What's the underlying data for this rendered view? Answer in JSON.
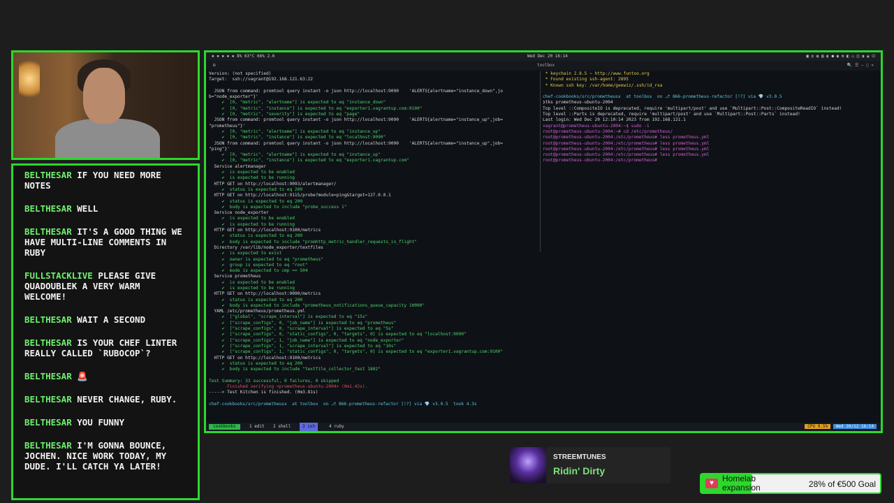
{
  "chat": [
    {
      "user": "BELTHESAR",
      "text": "IF YOU NEED MORE NOTES"
    },
    {
      "user": "BELTHESAR",
      "text": "WELL"
    },
    {
      "user": "BELTHESAR",
      "text": "IT'S A GOOD THING WE HAVE MULTI-LINE COMMENTS IN RUBY"
    },
    {
      "user": "FULLSTACKLIVE",
      "text": "PLEASE GIVE QUADOUBLEK A VERY WARM WELCOME!"
    },
    {
      "user": "BELTHESAR",
      "text": "WAIT A SECOND"
    },
    {
      "user": "BELTHESAR",
      "text": "IS YOUR CHEF LINTER REALLY CALLED `RUBOCOP`?"
    },
    {
      "user": "BELTHESAR",
      "text": "🚨"
    },
    {
      "user": "BELTHESAR",
      "text": "NEVER CHANGE, RUBY."
    },
    {
      "user": "BELTHESAR",
      "text": "YOU FUNNY"
    },
    {
      "user": "BELTHESAR",
      "text": "I'M GONNA BOUNCE, JOCHEN. NICE WORK TODAY, MY DUDE. I'LL CATCH YA LATER!"
    }
  ],
  "screen": {
    "sysbar_left": "▪ ▪ ▪ ▪ ▪   8%   63°C   66%   2.6",
    "sysbar_center": "Wed Dec 20 16:14",
    "window_title": "toolbox",
    "left_lines": [
      "Version: (not specified)",
      "Target:  ssh://vagrant@192.168.121.63:22",
      "",
      "  JSON from command: promtool query instant -o json http://localhost:9090    'ALERTS{alertname=\"instance_down\",jo",
      "b=\"node_exporter\"}'",
      "     ✔  [0, \"metric\", \"alertname\"] is expected to eq \"instance_down\"",
      "     ✔  [0, \"metric\", \"instance\"] is expected to eq \"exporter1.vagrantup.com:9100\"",
      "     ✔  [0, \"metric\", \"severity\"] is expected to eq \"page\"",
      "  JSON from command: promtool query instant -o json http://localhost:9090    'ALERTS{alertname=\"instance_up\",job=",
      "\"prometheus\"}'",
      "     ✔  [0, \"metric\", \"alertname\"] is expected to eq \"instance_up\"",
      "     ✔  [0, \"metric\", \"instance\"] is expected to eq \"localhost:9090\"",
      "  JSON from command: promtool query instant -o json http://localhost:9090    'ALERTS{alertname=\"instance_up\",job=",
      "\"ping\"}'",
      "     ✔  [0, \"metric\", \"alertname\"] is expected to eq \"instance_up\"",
      "     ✔  [0, \"metric\", \"instance\"] is expected to eq \"exporter1.vagrantup.com\"",
      "  Service alertmanager",
      "     ✔  is expected to be enabled",
      "     ✔  is expected to be running",
      "  HTTP GET on http://localhost:9093/alertmanager/",
      "     ✔  status is expected to eq 200",
      "  HTTP GET on http://localhost:9115/probe?module=ping&target=127.0.0.1",
      "     ✔  status is expected to eq 200",
      "     ✔  body is expected to include \"probe_success 1\"",
      "  Service node_exporter",
      "     ✔  is expected to be enabled",
      "     ✔  is expected to be running",
      "  HTTP GET on http://localhost:9100/metrics",
      "     ✔  status is expected to eq 200",
      "     ✔  body is expected to include \"promhttp_metric_handler_requests_in_flight\"",
      "  Directory /var/lib/node_exporter/textfiles",
      "     ✔  is expected to exist",
      "     ✔  owner is expected to eq \"prometheus\"",
      "     ✔  group is expected to eq \"root\"",
      "     ✔  mode is expected to cmp == 504",
      "  Service prometheus",
      "     ✔  is expected to be enabled",
      "     ✔  is expected to be running",
      "  HTTP GET on http://localhost:9090/metrics",
      "     ✔  status is expected to eq 200",
      "     ✔  body is expected to include \"prometheus_notifications_queue_capacity 10000\"",
      "  YAML /etc/prometheus/prometheus.yml",
      "     ✔  [\"global\", \"scrape_interval\"] is expected to eq \"15s\"",
      "     ✔  [\"scrape_configs\", 0, \"job_name\"] is expected to eq \"prometheus\"",
      "     ✔  [\"scrape_configs\", 0, \"scrape_interval\"] is expected to eq \"5s\"",
      "     ✔  [\"scrape_configs\", 0, \"static_configs\", 0, \"targets\", 0] is expected to eq \"localhost:9090\"",
      "     ✔  [\"scrape_configs\", 1, \"job_name\"] is expected to eq \"node_exporter\"",
      "     ✔  [\"scrape_configs\", 1, \"scrape_interval\"] is expected to eq \"10s\"",
      "     ✔  [\"scrape_configs\", 1, \"static_configs\", 0, \"targets\", 0] is expected to eq \"exporter1.vagrantup.com:9100\"",
      "  HTTP GET on http://localhost:9100/metrics",
      "     ✔  status is expected to eq 200",
      "     ✔  body is expected to include \"textfile_collector_test 1802\"",
      "",
      "Test Summary: 33 successful, 0 failures, 0 skipped",
      "       Finished verifying <prometheus-ubuntu-2004> (0m1.42s).",
      "-----> Test Kitchen is finished. (0m3.81s)",
      "",
      "chef-cookbooks/src/prometheusx  at toolbox  on ⎇ 866-prometheus-refactor [!?] via 💎 v3.0.5  took 4.3s",
      "❯"
    ],
    "right_lines": [
      " * keychain 2.8.5 ~ http://www.funtoo.org",
      " * Found existing ssh-agent: 2895",
      " * Known ssh key: /var/home/geewiz/.ssh/id_rsa",
      "",
      "chef-cookbooks/src/prometheusx  at toolbox  on ⎇ 866-prometheus-refactor [!?] via 💎 v3.0.5",
      "❯tks prometheus-ubuntu-2004",
      "Top level ::CompositeIO is deprecated, require 'multipart/post' and use `Multipart::Post::CompositeReadIO` instead!",
      "Top level ::Parts is deprecated, require 'multipart/post' and use `Multipart::Post::Parts` instead!",
      "Last login: Wed Dec 20 12:10:14 2023 from 192.168.121.1",
      "vagrant@prometheus-ubuntu-2004:~$ sudo -i",
      "root@prometheus-ubuntu-2004:~# cd /etc/prometheus/",
      "root@prometheus-ubuntu-2004:/etc/prometheus# less prometheus.yml",
      "root@prometheus-ubuntu-2004:/etc/prometheus# less prometheus.yml",
      "root@prometheus-ubuntu-2004:/etc/prometheus# less prometheus.yml",
      "root@prometheus-ubuntu-2004:/etc/prometheus# less prometheus.yml",
      "root@prometheus-ubuntu-2004:/etc/prometheus# "
    ],
    "tabbar": {
      "session": "cookbooks",
      "tabs": [
        "1 edit",
        "2 shell",
        "3 zsh",
        "4 ruby"
      ],
      "active_tab": 2,
      "cpu": "CPU 9.5%",
      "datetime": "Wed 20/12 16:14"
    }
  },
  "music": {
    "label": "STREEMTUNES",
    "song": "Ridin' Dirty"
  },
  "goal": {
    "title": "Homelab expansion",
    "amount": "28% of €500 Goal",
    "progress_fraction": 0.28
  }
}
